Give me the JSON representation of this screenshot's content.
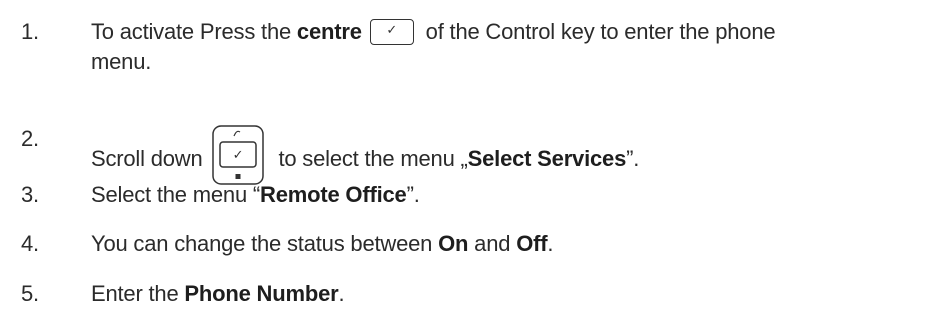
{
  "steps": [
    {
      "number": "1.",
      "before": "To activate Press the ",
      "bold1": "centre",
      "after": " of the Control key to enter the phone",
      "line2": "menu.",
      "icon": "ok-check-key-icon"
    },
    {
      "number": "2.",
      "before": "Scroll down",
      "after": " to select the menu „",
      "bold1": "Select Services",
      "tail": "”.",
      "icon": "navigation-key-icon"
    },
    {
      "number": "3.",
      "before": "Select the menu “",
      "bold1": "Remote Office",
      "tail": "”."
    },
    {
      "number": "4.",
      "before": "You can change the status between ",
      "bold1": "On",
      "middle": " and ",
      "bold2": "Off",
      "tail": "."
    },
    {
      "number": "5.",
      "before": "Enter the ",
      "bold1": "Phone Number",
      "tail": "."
    }
  ]
}
